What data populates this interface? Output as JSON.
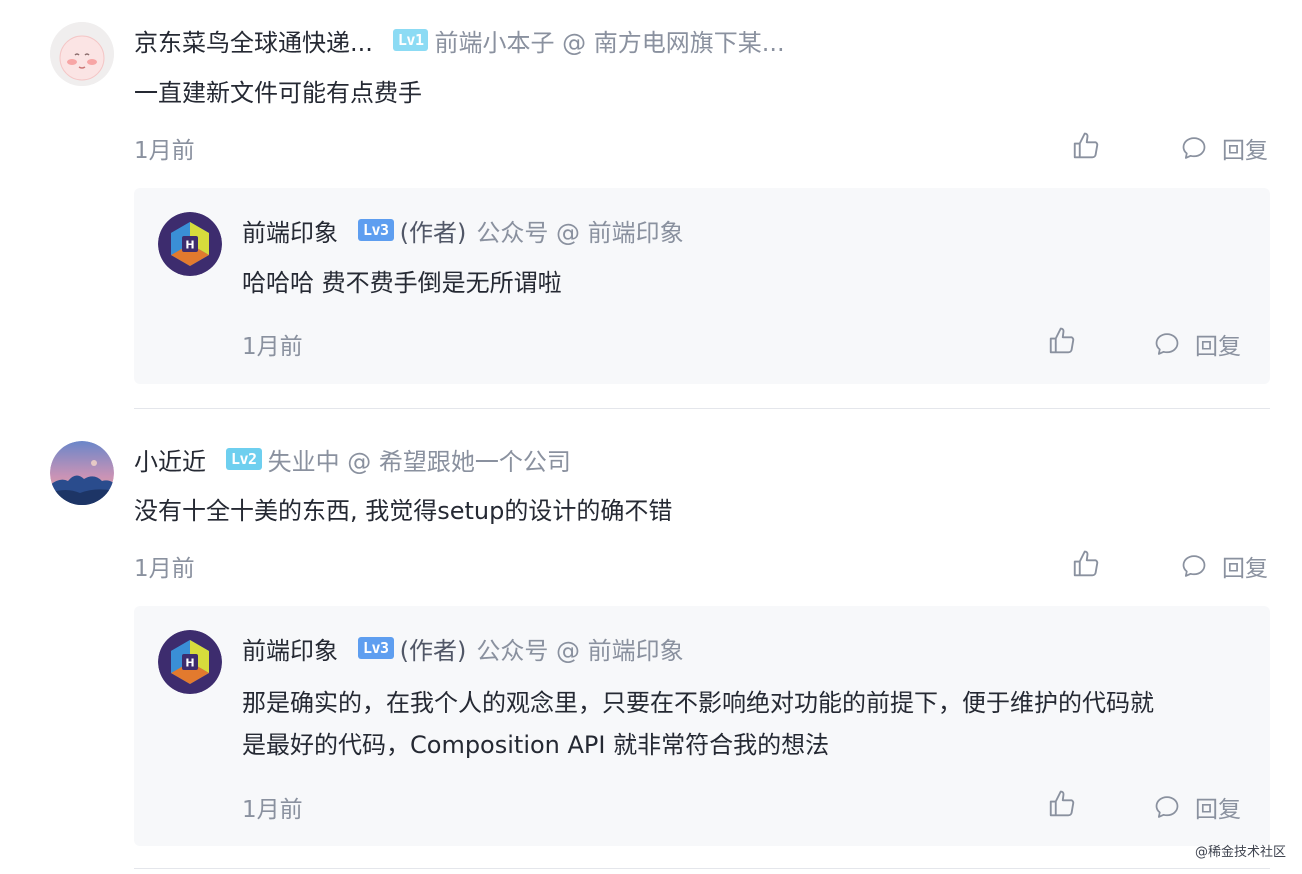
{
  "comments": [
    {
      "username": "京东菜鸟全球通快递...",
      "level": "Lv1",
      "meta": "前端小本子 @ 南方电网旗下某...",
      "content": "一直建新文件可能有点费手",
      "time": "1月前",
      "reply_label": "回复",
      "reply": {
        "username": "前端印象",
        "level": "Lv3",
        "author_tag": "(作者)",
        "meta": "公众号 @ 前端印象",
        "content": "哈哈哈 费不费手倒是无所谓啦",
        "time": "1月前",
        "reply_label": "回复"
      }
    },
    {
      "username": "小近近",
      "level": "Lv2",
      "meta": "失业中 @ 希望跟她一个公司",
      "content": "没有十全十美的东西, 我觉得setup的设计的确不错",
      "time": "1月前",
      "reply_label": "回复",
      "reply": {
        "username": "前端印象",
        "level": "Lv3",
        "author_tag": "(作者)",
        "meta": "公众号 @ 前端印象",
        "content_line1": "那是确实的，在我个人的观念里，只要在不影响绝对功能的前提下，便于维护的代码就",
        "content_line2": "是最好的代码，Composition API 就非常符合我的想法",
        "time": "1月前",
        "reply_label": "回复"
      }
    }
  ],
  "avatar_letter": "H",
  "watermark": "@稀金技术社区",
  "colors": {
    "text": "#252933",
    "meta": "#8a919f",
    "reply_bg": "#f7f8fa",
    "lv1": "#8cdbf4",
    "lv3": "#5e9ef0"
  }
}
